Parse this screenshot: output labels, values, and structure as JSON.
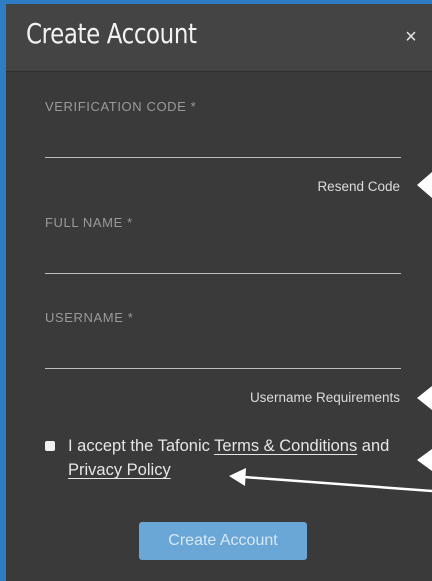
{
  "dialog": {
    "title": "Create Account",
    "close_glyph": "×"
  },
  "form": {
    "verification_code": {
      "label": "VERIFICATION CODE *",
      "value": ""
    },
    "resend_code_label": "Resend Code",
    "full_name": {
      "label": "FULL NAME *",
      "value": ""
    },
    "username": {
      "label": "USERNAME *",
      "value": ""
    },
    "username_requirements_label": "Username Requirements",
    "terms": {
      "prefix": "I accept the Tafonic ",
      "terms_link": "Terms & Conditions",
      "conjunction": " and ",
      "privacy_link": "Privacy Policy",
      "checked": false
    },
    "submit_label": "Create Account"
  },
  "colors": {
    "frame_accent": "#2d7cc4",
    "dialog_background": "#3a3a3a",
    "header_background": "#444444",
    "submit_button": "#6aa6d6",
    "annotation_arrow": "#ffffff"
  },
  "icons": {
    "close": "close-icon",
    "checkbox": "checkbox-icon"
  }
}
